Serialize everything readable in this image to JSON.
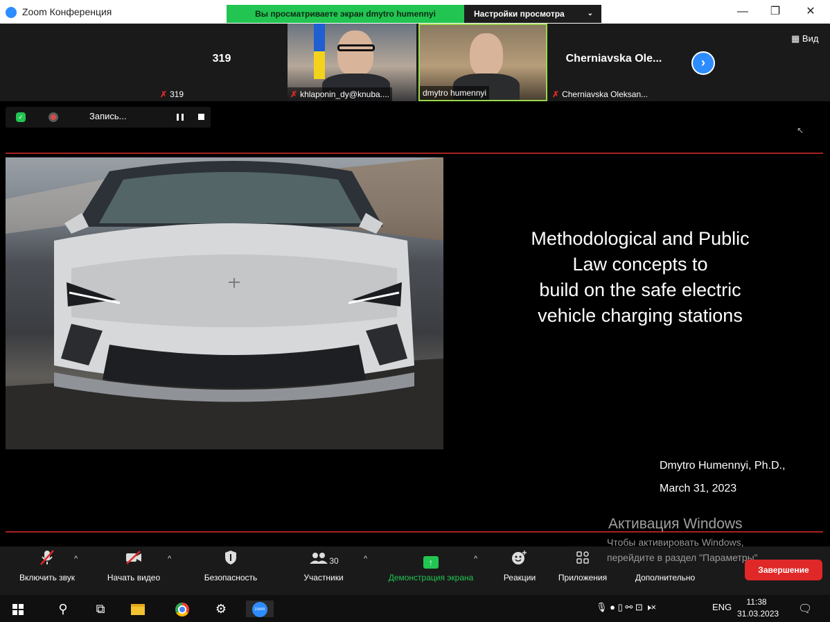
{
  "window": {
    "title": "Zoom Конференция",
    "share_banner": "Вы просматриваете экран dmytro humennyi",
    "view_settings": "Настройки просмотра",
    "min_icon": "—",
    "max_icon": "❐",
    "close_icon": "✕"
  },
  "participants": [
    {
      "big_label": "319",
      "name": "319",
      "muted": true
    },
    {
      "name": "khlaponin_dy@knuba....",
      "muted": true
    },
    {
      "name": "dmytro humennyi",
      "muted": false,
      "active_speaker": true
    },
    {
      "big_label": "Cherniavska  Ole...",
      "name": "Cherniavska Oleksan...",
      "muted": true
    }
  ],
  "strip": {
    "view_label": "Вид",
    "next_glyph": "›"
  },
  "recording": {
    "label": "Запись...",
    "shield_glyph": "✓"
  },
  "slide": {
    "title_lines": [
      "Methodological and Public",
      "Law concepts to",
      "build on the safe electric",
      "vehicle charging stations"
    ],
    "author": "Dmytro Humennyi, Ph.D.,",
    "date": "March 31, 2023",
    "cursor_glyph": "↖"
  },
  "activation": {
    "title": "Активация Windows",
    "line1": "Чтобы активировать Windows,",
    "line2": "перейдите в раздел \"Параметры\"."
  },
  "toolbar": {
    "unmute": "Включить звук",
    "start_video": "Начать видео",
    "security": "Безопасность",
    "participants": "Участники",
    "participants_count": "30",
    "share": "Демонстрация экрана",
    "reactions": "Реакции",
    "apps": "Приложения",
    "more": "Дополнительно",
    "end": "Завершение",
    "caret": "^",
    "share_arrow": "↑"
  },
  "taskbar": {
    "search_glyph": "⚲",
    "taskview_glyph": "⧉",
    "settings_glyph": "⚙",
    "zoom_app_label": "zoom",
    "language": "ENG",
    "time": "11:38",
    "date": "31.03.2023",
    "tray_glyphs": "🎙 ● ▯ ⚯ ⊡ 🕨×",
    "notify_glyph": "🗨"
  },
  "colors": {
    "share_green": "#23c552",
    "zoom_blue": "#2d8cff",
    "end_red": "#e02828",
    "slide_rule": "#a82121"
  },
  "icons": {
    "unmute": "mic-off-icon",
    "start_video": "video-off-icon",
    "security": "shield-icon",
    "participants": "people-icon",
    "share": "share-screen-icon",
    "reactions": "emoji-icon",
    "apps": "apps-icon"
  }
}
